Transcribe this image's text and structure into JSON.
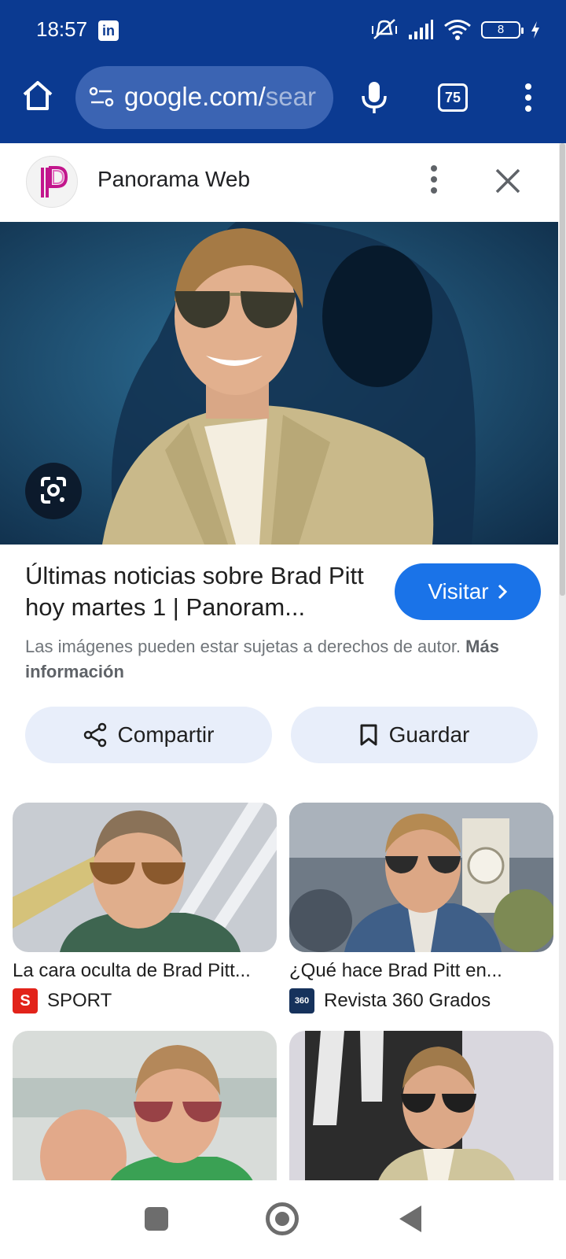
{
  "status_bar": {
    "time": "18:57",
    "battery": "8",
    "notification_icon": "linkedin-icon"
  },
  "toolbar": {
    "url_visible": "google.com/",
    "url_faded": "sear",
    "tab_count": "75"
  },
  "source": {
    "name": "Panorama Web",
    "logo_letter": "P"
  },
  "result": {
    "title": "Últimas noticias sobre Brad Pitt hoy martes 1 | Panoram...",
    "visit_label": "Visitar",
    "copyright_text": "Las imágenes pueden estar sujetas a derechos de autor.",
    "copyright_link": "Más información"
  },
  "actions": {
    "share_label": "Compartir",
    "save_label": "Guardar"
  },
  "related": [
    {
      "title": "La cara oculta de Brad Pitt...",
      "source": "SPORT",
      "favicon_text": "S",
      "favicon_color": "#e2231a"
    },
    {
      "title": "¿Qué hace Brad Pitt en...",
      "source": "Revista 360 Grados",
      "favicon_text": "360",
      "favicon_color": "#16325c"
    },
    {
      "title": "",
      "source": ""
    },
    {
      "title": "",
      "source": ""
    }
  ],
  "colors": {
    "toolbar_blue": "#0b3a91",
    "url_pill": "#3b64b3",
    "visit_blue": "#1a73e8",
    "pill_bg": "#e8eefa"
  }
}
